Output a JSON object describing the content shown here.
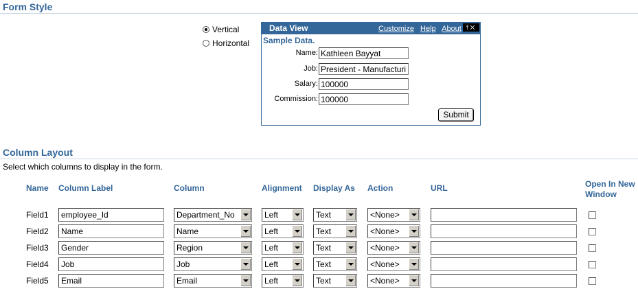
{
  "form_style": {
    "title": "Form Style",
    "options": [
      {
        "label": "Vertical",
        "selected": true
      },
      {
        "label": "Horizontal",
        "selected": false
      }
    ]
  },
  "data_view": {
    "title": "Data View",
    "links": [
      "Customize",
      "Help",
      "About"
    ],
    "sample_title": "Sample Data.",
    "fields": [
      {
        "label": "Name:",
        "value": "Kathleen Bayyat"
      },
      {
        "label": "Job:",
        "value": "President - Manufacturi"
      },
      {
        "label": "Salary:",
        "value": "100000"
      },
      {
        "label": "Commission:",
        "value": "100000"
      }
    ],
    "submit_label": "Submit"
  },
  "column_layout": {
    "title": "Column Layout",
    "instruction": "Select which columns to display in the form.",
    "headers": {
      "name": "Name",
      "column_label": "Column Label",
      "column": "Column",
      "alignment": "Alignment",
      "display_as": "Display As",
      "action": "Action",
      "url": "URL",
      "open_new_window_1": "Open In New",
      "open_new_window_2": "Window"
    },
    "rows": [
      {
        "name": "Field1",
        "label": "employee_Id",
        "column": "Department_No",
        "alignment": "Left",
        "display_as": "Text",
        "action": "<None>",
        "url": "",
        "new_window": false
      },
      {
        "name": "Field2",
        "label": "Name",
        "column": "Name",
        "alignment": "Left",
        "display_as": "Text",
        "action": "<None>",
        "url": "",
        "new_window": false
      },
      {
        "name": "Field3",
        "label": "Gender",
        "column": "Region",
        "alignment": "Left",
        "display_as": "Text",
        "action": "<None>",
        "url": "",
        "new_window": false
      },
      {
        "name": "Field4",
        "label": "Job",
        "column": "Job",
        "alignment": "Left",
        "display_as": "Text",
        "action": "<None>",
        "url": "",
        "new_window": false
      },
      {
        "name": "Field5",
        "label": "Email",
        "column": "Email",
        "alignment": "Left",
        "display_as": "Text",
        "action": "<None>",
        "url": "",
        "new_window": false
      }
    ]
  }
}
